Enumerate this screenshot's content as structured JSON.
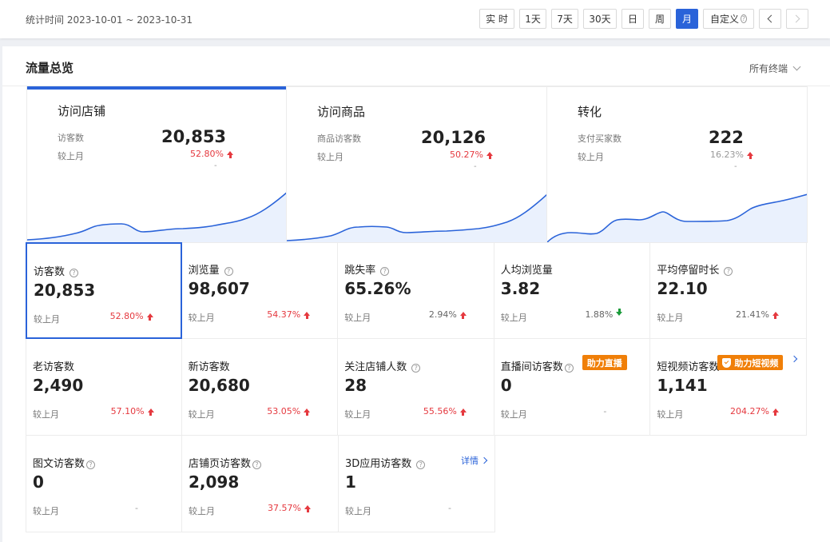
{
  "header": {
    "range_text": "统计时间 2023-10-01 ~ 2023-10-31",
    "buttons": [
      "实 时",
      "1天",
      "7天",
      "30天",
      "日",
      "周",
      "月",
      "自定义"
    ],
    "active_button": "月"
  },
  "panel": {
    "title": "流量总览",
    "terminal": "所有终端"
  },
  "top_cards": [
    {
      "title": "访问店铺",
      "label": "访客数",
      "value": "20,853",
      "cmp": "较上月",
      "pct": "52.80%",
      "dash": "-"
    },
    {
      "title": "访问商品",
      "label": "商品访客数",
      "value": "20,126",
      "cmp": "较上月",
      "pct": "50.27%",
      "dash": "-"
    },
    {
      "title": "转化",
      "label": "支付买家数",
      "value": "222",
      "cmp": "较上月",
      "pct": "16.23%",
      "dash": "-"
    }
  ],
  "metrics": [
    [
      {
        "label": "访客数",
        "value": "20,853",
        "cmp": "较上月",
        "pct": "52.80%",
        "trend": "up"
      },
      {
        "label": "浏览量",
        "value": "98,607",
        "cmp": "较上月",
        "pct": "54.37%",
        "trend": "up"
      },
      {
        "label": "跳失率",
        "value": "65.26%",
        "cmp": "较上月",
        "pct": "2.94%",
        "trend": "up"
      },
      {
        "label": "人均浏览量",
        "value": "3.82",
        "cmp": "较上月",
        "pct": "1.88%",
        "trend": "down"
      },
      {
        "label": "平均停留时长",
        "value": "22.10",
        "cmp": "较上月",
        "pct": "21.41%",
        "trend": "up"
      }
    ],
    [
      {
        "label": "老访客数",
        "value": "2,490",
        "cmp": "较上月",
        "pct": "57.10%",
        "trend": "up"
      },
      {
        "label": "新访客数",
        "value": "20,680",
        "cmp": "较上月",
        "pct": "53.05%",
        "trend": "up"
      },
      {
        "label": "关注店铺人数",
        "value": "28",
        "cmp": "较上月",
        "pct": "55.56%",
        "trend": "up"
      },
      {
        "label": "直播间访客数",
        "value": "0",
        "cmp": "较上月",
        "pct": "-",
        "trend": "none",
        "tag": "助力直播"
      },
      {
        "label": "短视频访客数",
        "value": "1,141",
        "cmp": "较上月",
        "pct": "204.27%",
        "trend": "up",
        "tag": "助力短视频"
      }
    ],
    [
      {
        "label": "图文访客数",
        "value": "0",
        "cmp": "较上月",
        "pct": "-",
        "trend": "none"
      },
      {
        "label": "店铺页访客数",
        "value": "2,098",
        "cmp": "较上月",
        "pct": "37.57%",
        "trend": "up"
      },
      {
        "label": "3D应用访客数",
        "value": "1",
        "cmp": "较上月",
        "pct": "-",
        "trend": "none",
        "detail": "详情"
      }
    ]
  ],
  "colors": {
    "accent": "#2a63d9",
    "up": "#e5393f",
    "down": "#1a9b3a",
    "tag": "#f07f08"
  }
}
